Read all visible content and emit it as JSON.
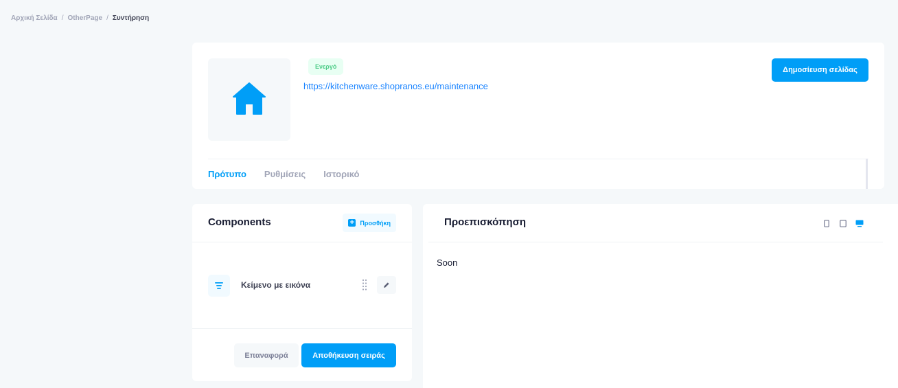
{
  "breadcrumb": {
    "items": [
      "Αρχική Σελίδα",
      "OtherPage",
      "Συντήρηση"
    ],
    "separator": "/"
  },
  "header": {
    "thumbnail_icon": "home-icon",
    "status": "Ενεργό",
    "url": "https://kitchenware.shopranos.eu/maintenance",
    "publish_label": "Δημοσίευση σελίδας",
    "tabs": [
      {
        "label": "Πρότυπο",
        "active": true
      },
      {
        "label": "Ρυθμίσεις",
        "active": false
      },
      {
        "label": "Ιστορικό",
        "active": false
      }
    ]
  },
  "components": {
    "title": "Components",
    "add_label": "Προσθήκη",
    "items": [
      {
        "label": "Κείμενο με εικόνα",
        "icon": "text-align-icon"
      }
    ],
    "reset_label": "Επαναφορά",
    "save_order_label": "Αποθήκευση σειράς"
  },
  "preview": {
    "title": "Προεπισκόπηση",
    "devices": [
      {
        "icon": "mobile-icon",
        "active": false
      },
      {
        "icon": "tablet-icon",
        "active": false
      },
      {
        "icon": "desktop-icon",
        "active": true
      }
    ],
    "content": "Soon"
  },
  "colors": {
    "primary": "#009ef7",
    "success_bg": "#e8fff3",
    "success_text": "#50cd89",
    "muted": "#a1a5b7",
    "page_bg": "#f5f8fa"
  }
}
